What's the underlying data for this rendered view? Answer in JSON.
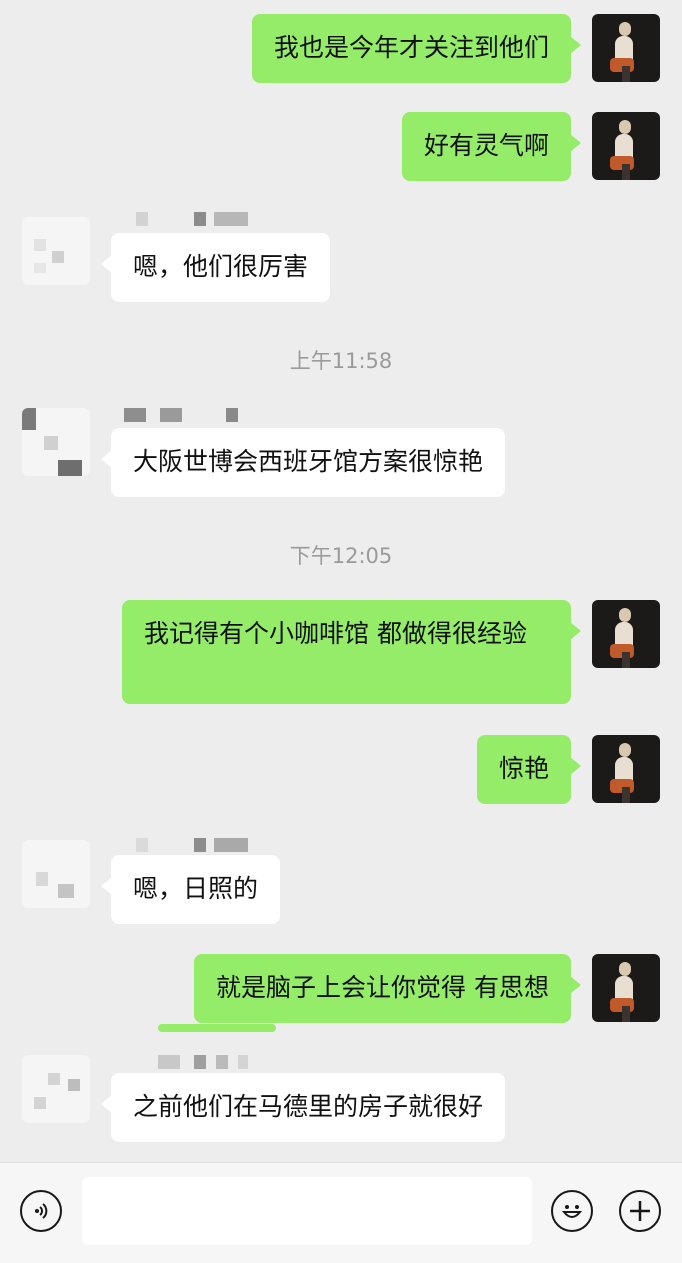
{
  "messages": [
    {
      "side": "self",
      "text": "我也是今年才关注到他们"
    },
    {
      "side": "self",
      "text": "好有灵气啊"
    },
    {
      "side": "other",
      "text": "嗯，他们很厉害"
    },
    {
      "side": "other",
      "text": "大阪世博会西班牙馆方案很惊艳"
    },
    {
      "side": "self",
      "text": "我记得有个小咖啡馆 都做得很经验"
    },
    {
      "side": "self",
      "text": "惊艳"
    },
    {
      "side": "other",
      "text": "嗯，日照的"
    },
    {
      "side": "self",
      "text": "就是脑子上会让你觉得 有思想"
    },
    {
      "side": "other",
      "text": "之前他们在马德里的房子就很好"
    }
  ],
  "timestamps": [
    "上午11:58",
    "下午12:05"
  ],
  "colors": {
    "self_bubble": "#95ec69",
    "other_bubble": "#ffffff",
    "background": "#ededed"
  },
  "input_bar": {
    "text_value": "",
    "voice_icon": "voice-icon",
    "emoji_icon": "emoji-icon",
    "more_icon": "plus-icon"
  }
}
